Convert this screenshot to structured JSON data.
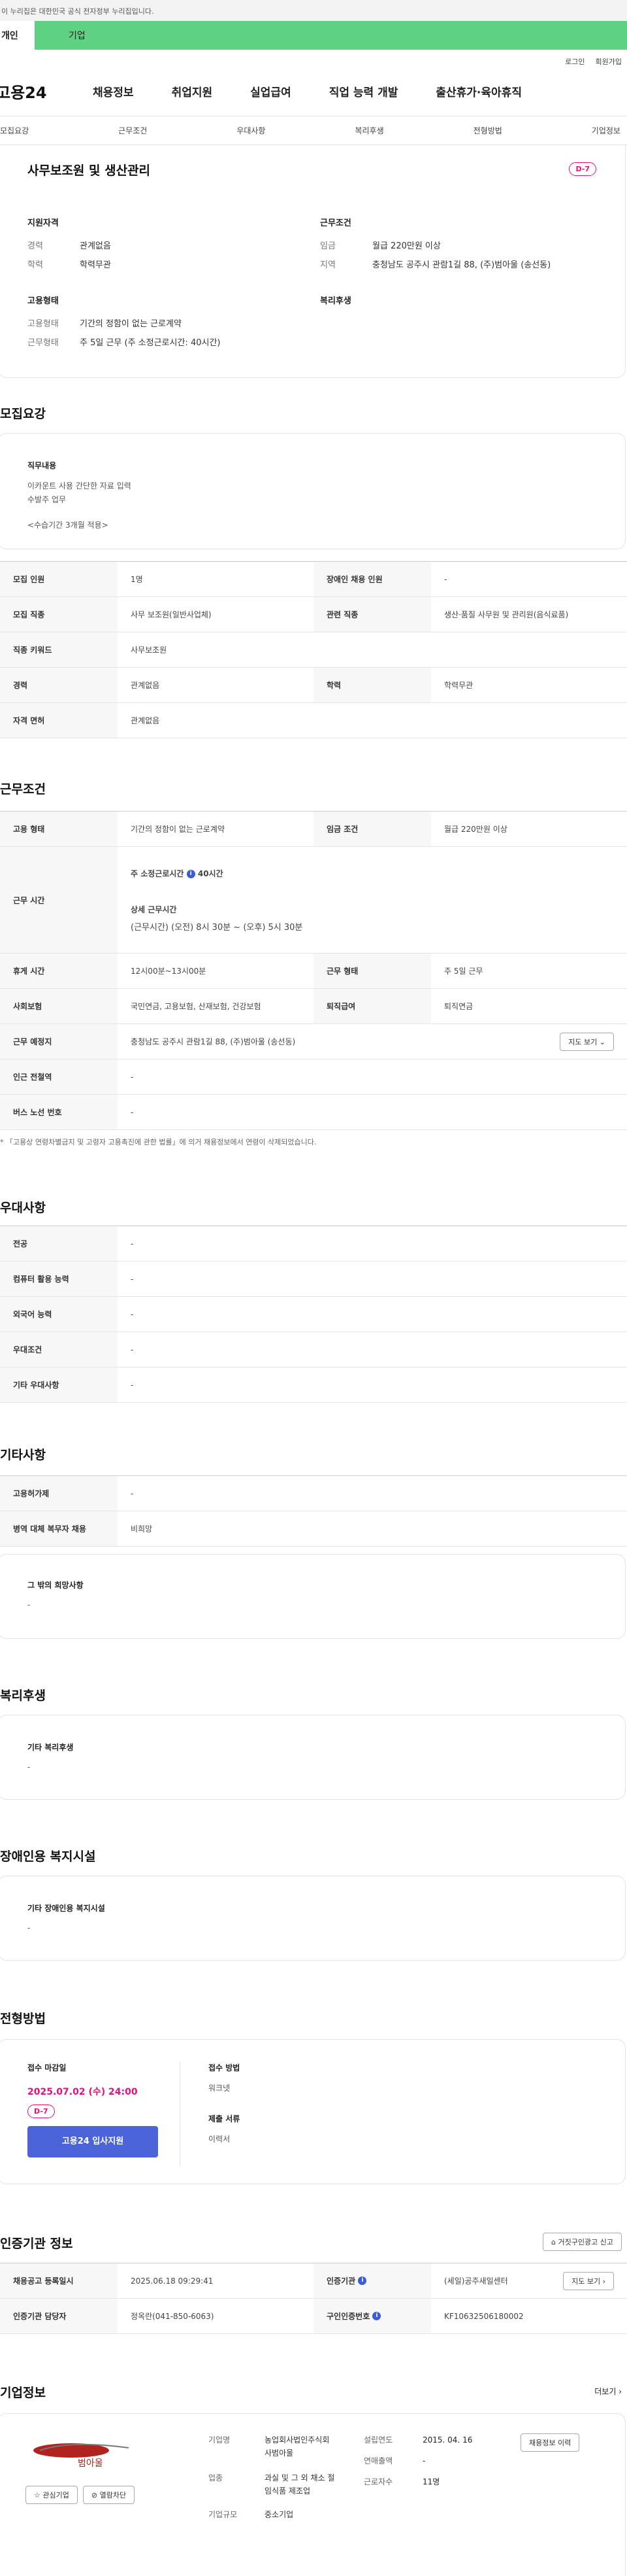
{
  "gov_banner": "이 누리집은 대한민국 공식 전자정부 누리집입니다.",
  "user_tabs": {
    "personal": "개인",
    "corporate": "기업"
  },
  "util": {
    "login": "로그인",
    "signup": "회원가입"
  },
  "logo": "고용24",
  "gnb": [
    "채용정보",
    "취업지원",
    "실업급여",
    "직업 능력 개발",
    "출산휴가·육아휴직"
  ],
  "anchors": [
    "모집요강",
    "근무조건",
    "우대사항",
    "복리후생",
    "전형방법",
    "기업정보"
  ],
  "summary": {
    "title": "사무보조원 및 생산관리",
    "dday": "D-7",
    "qual_h": "지원자격",
    "exp_k": "경력",
    "exp_v": "관계없음",
    "edu_k": "학력",
    "edu_v": "학력무관",
    "cond_h": "근무조건",
    "wage_k": "임금",
    "wage_v": "월급 220만원 이상",
    "region_k": "지역",
    "region_v": "충청남도 공주시 관람1길 88, (주)범아울 (송선동)",
    "emp_h": "고용형태",
    "emptype_k": "고용형태",
    "emptype_v": "기간의 정함이 없는 근로계약",
    "worktype_k": "근무형태",
    "worktype_v": "주 5일 근무 (주 소정근로시간: 40시간)",
    "welfare_h": "복리후생"
  },
  "recruit": {
    "heading": "모집요강",
    "duty_h": "직무내용",
    "duty_lines": [
      "이카운트 사용 간단한 자료 입력",
      "수발주 업무"
    ],
    "probation": "<수습기간 3개월 적용>",
    "rows": [
      [
        "모집 인원",
        "1명",
        "장애인 채용 인원",
        "-"
      ],
      [
        "모집 직종",
        "사무 보조원(일반사업체)",
        "관련 직종",
        "생산·품질 사무원 및 관리원(음식료품)"
      ],
      [
        "직종 키워드",
        "사무보조원"
      ],
      [
        "경력",
        "관계없음",
        "학력",
        "학력무관"
      ],
      [
        "자격 면허",
        "관계없음"
      ]
    ]
  },
  "cond": {
    "heading": "근무조건",
    "emp_k": "고용 형태",
    "emp_v": "기간의 정함이 없는 근로계약",
    "wage_k": "임금 조건",
    "wage_v": "월급 220만원 이상",
    "hours_k": "근무 시간",
    "hours_total": "주 소정근로시간",
    "hours_total_v": "40시간",
    "hours_detail_h": "상세 근무시간",
    "hours_detail": "(근무시간) (오전) 8시 30분 ~ (오후) 5시 30분",
    "rest_k": "휴게 시간",
    "rest_v": "12시00분~13시00분",
    "wtype_k": "근무 형태",
    "wtype_v": "주 5일 근무",
    "ins_k": "사회보험",
    "ins_v": "국민연금, 고용보험, 산재보험, 건강보험",
    "sev_k": "퇴직급여",
    "sev_v": "퇴직연금",
    "place_k": "근무 예정지",
    "place_v": "충청남도 공주시 관람1길 88, (주)범아울 (송선동)",
    "map_btn": "지도 보기",
    "subway_k": "인근 전철역",
    "subway_v": "-",
    "bus_k": "버스 노선 번호",
    "bus_v": "-",
    "note": "* 「고용상 연령차별금지 및 고령자 고용촉진에 관한 법률」에 의거 채용정보에서 연령이 삭제되었습니다."
  },
  "pref": {
    "heading": "우대사항",
    "rows": [
      [
        "전공",
        "-"
      ],
      [
        "컴퓨터 활용 능력",
        "-"
      ],
      [
        "외국어 능력",
        "-"
      ],
      [
        "우대조건",
        "-"
      ],
      [
        "기타 우대사항",
        "-"
      ]
    ]
  },
  "etc": {
    "heading": "기타사항",
    "rows": [
      [
        "고용허가제",
        "-"
      ],
      [
        "병역 대체 복무자 채용",
        "비희망"
      ]
    ],
    "other_h": "그 밖의 희망사항",
    "other_v": "-"
  },
  "welfare": {
    "heading": "복리후생",
    "box_h": "기타 복리후생",
    "box_v": "-"
  },
  "disabled": {
    "heading": "장애인용 복지시설",
    "box_h": "기타 장애인용 복지시설",
    "box_v": "-"
  },
  "selection": {
    "heading": "전형방법",
    "deadline_h": "접수 마감일",
    "deadline_v": "2025.07.02 (수) 24:00",
    "dday": "D-7",
    "apply_btn": "고용24 입사지원",
    "method_h": "접수 방법",
    "method_v": "워크넷",
    "docs_h": "제출 서류",
    "docs_v": "이력서"
  },
  "cert": {
    "heading": "인증기관 정보",
    "report_btn": "거짓구인광고 신고",
    "reg_k": "채용공고 등록일시",
    "reg_v": "2025.06.18 09:29:41",
    "org_k": "인증기관",
    "org_v": "(세일)공주새일센터",
    "map_btn": "지도 보기",
    "mgr_k": "인증기관 담당자",
    "mgr_v": "정옥란(041-850-6063)",
    "num_k": "구인인증번호",
    "num_v": "KF10632506180002"
  },
  "company": {
    "heading": "기업정보",
    "more": "더보기",
    "history_btn": "채용정보 이력",
    "fav_btn": "관심기업",
    "block_btn": "열람차단",
    "logo_text": "범아울",
    "name_k": "기업명",
    "name_v": "농업회사법인주식회사범아울",
    "ind_k": "업종",
    "ind_v": "과실 및 그 외 채소 절임식품 제조업",
    "size_k": "기업규모",
    "size_v": "중소기업",
    "est_k": "설립연도",
    "est_v": "2015. 04. 16",
    "sales_k": "연매출액",
    "sales_v": "-",
    "staff_k": "근로자수",
    "staff_v": "11명"
  }
}
